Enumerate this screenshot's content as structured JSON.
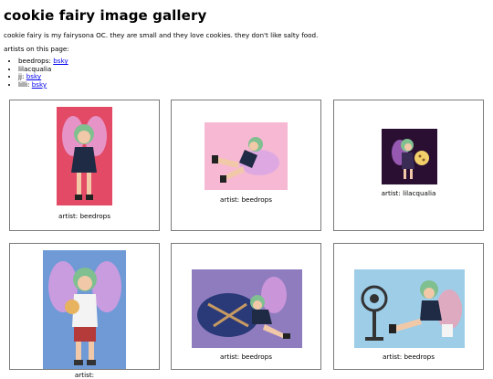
{
  "page": {
    "title": "cookie fairy image gallery",
    "intro": "cookie fairy is my fairysona OC. they are small and they love cookies. they don't like salty food.",
    "artists_heading": "artists on this page:"
  },
  "artists": [
    {
      "name": "beedrops:",
      "link": "bsky"
    },
    {
      "name": "lilacqualia",
      "link": ""
    },
    {
      "name": "jj:",
      "link": "bsky"
    },
    {
      "name": "lilli:",
      "link": "bsky"
    }
  ],
  "gallery": [
    {
      "caption": "artist: beedrops",
      "image": "fairy-standing-red-background"
    },
    {
      "caption": "artist: beedrops",
      "image": "fairy-floating-pink-background"
    },
    {
      "caption": "artist: lilacqualia",
      "image": "fairy-holding-cookie-dark-background"
    },
    {
      "caption": "artist: ",
      "image": "fairy-holding-cookie-blue-background"
    },
    {
      "caption": "artist: beedrops",
      "image": "fairy-on-cushion-purple-background"
    },
    {
      "caption": "artist: beedrops",
      "image": "fairy-with-fan-blue-background"
    }
  ],
  "colors": {
    "link": "#0000ee",
    "card_border": "#7a7a7a",
    "fairy_hair": "#7fb88c",
    "wing": "#d99be0"
  }
}
